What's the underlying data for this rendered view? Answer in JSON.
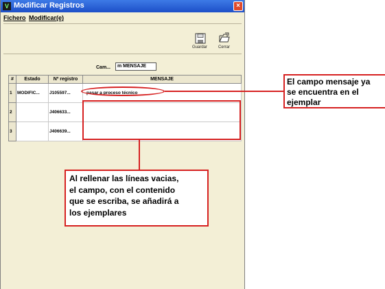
{
  "window": {
    "title": "Modificar Registros",
    "close_glyph": "×"
  },
  "menu": {
    "items": [
      "Fichero",
      "Modificar(e)"
    ]
  },
  "toolbar": {
    "save_label": "Guardar",
    "close_label": "Cerrar"
  },
  "field": {
    "label": "Cam...",
    "value": "m MENSAJE"
  },
  "table": {
    "columns": [
      "#",
      "Estado",
      "Nº registro",
      "MENSAJE"
    ],
    "rows": [
      {
        "num": "1",
        "estado": "MODIFIC...",
        "registro": "J105597...",
        "mensaje": "pasar a proceso técnico"
      },
      {
        "num": "2",
        "estado": "",
        "registro": "J406633...",
        "mensaje": ""
      },
      {
        "num": "3",
        "estado": "",
        "registro": "J406639...",
        "mensaje": ""
      }
    ]
  },
  "annotations": {
    "right_callout": [
      "El campo mensaje ya",
      "se encuentra en el",
      "ejemplar"
    ],
    "bottom_callout": [
      "Al rellenar las líneas vacias,",
      "el campo, con el contenido",
      "que se escriba, se añadirá a",
      "los ejemplares"
    ]
  },
  "colors": {
    "titlebar": "#2a63d8",
    "window_bg": "#f3efd6",
    "annotation_red": "#d62020",
    "close_button": "#e04a2b"
  },
  "icons": {
    "app": "app-icon",
    "save": "floppy-disk-icon",
    "close": "open-folder-icon",
    "window_close": "close-icon"
  }
}
